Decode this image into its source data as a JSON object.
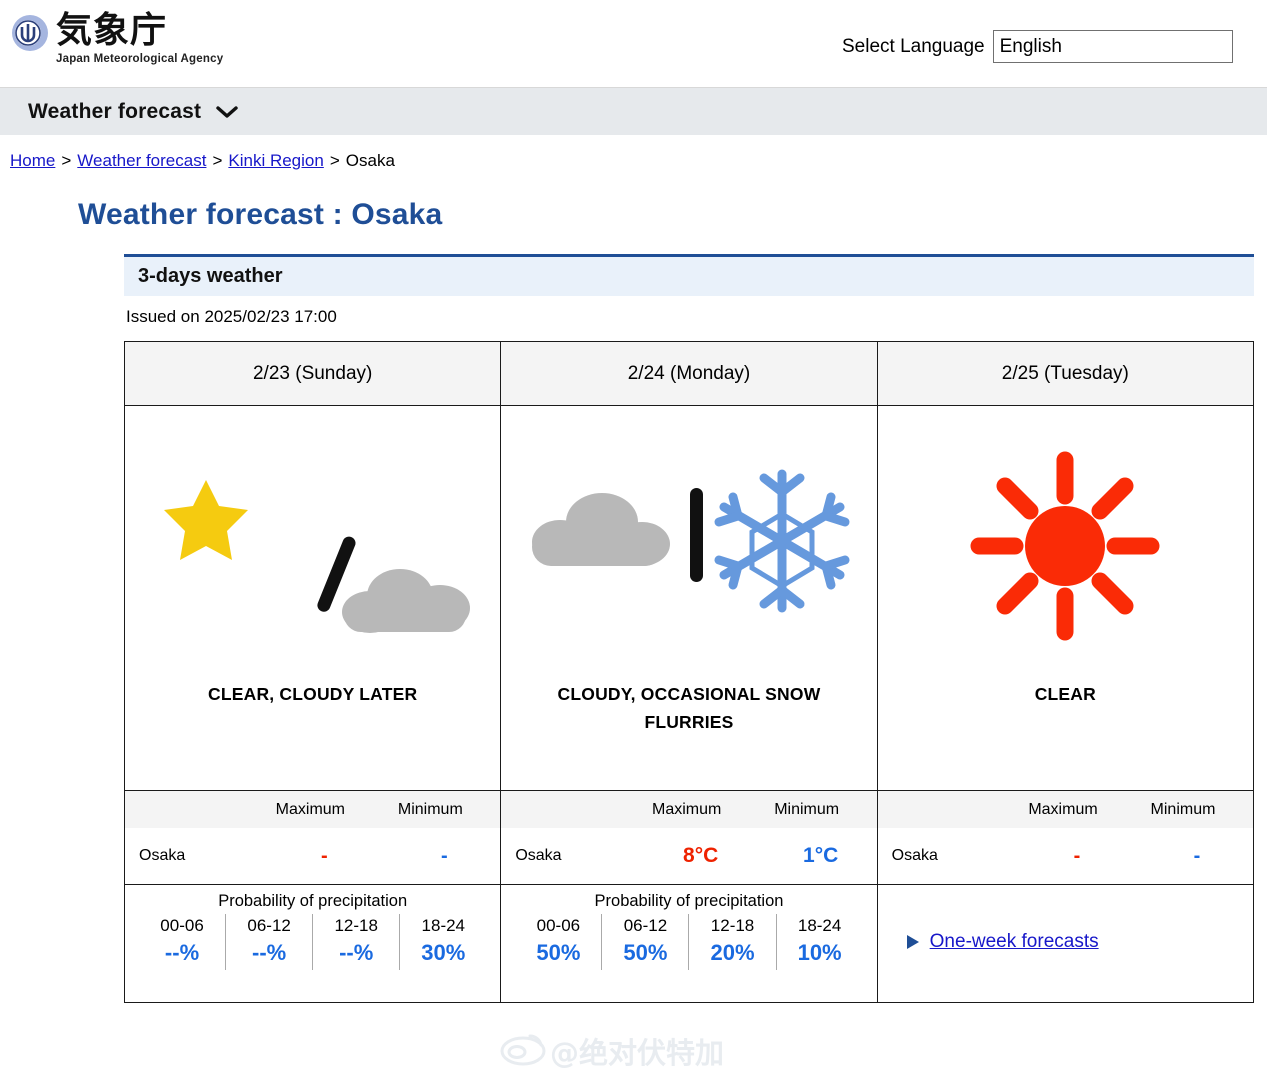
{
  "header": {
    "agency_jp": "気象庁",
    "agency_en": "Japan Meteorological Agency",
    "logo_icon": "jma-logo-icon",
    "language_label": "Select Language",
    "language_value": "English",
    "language_options": [
      "English"
    ]
  },
  "nav": {
    "title": "Weather forecast",
    "chevron_icon": "chevron-down-icon"
  },
  "breadcrumb": {
    "items": [
      {
        "label": "Home",
        "link": true
      },
      {
        "label": "Weather forecast",
        "link": true
      },
      {
        "label": "Kinki Region",
        "link": true
      },
      {
        "label": "Osaka",
        "link": false
      }
    ],
    "separator": ">"
  },
  "page": {
    "title": "Weather forecast : Osaka",
    "section_title": "3-days weather",
    "issued": "Issued on 2025/02/23 17:00",
    "accent_color": "#1f4e96"
  },
  "table": {
    "temp_headers": {
      "maximum": "Maximum",
      "minimum": "Minimum"
    },
    "pop_title": "Probability of precipitation",
    "pop_hours": [
      "00-06",
      "06-12",
      "12-18",
      "18-24"
    ],
    "city": "Osaka",
    "max_color": "#ee2200",
    "min_color": "#1a6ae0",
    "days": [
      {
        "date": "2/23 (Sunday)",
        "icon": "moon-star-to-cloud-icon",
        "weather": "CLEAR, CLOUDY LATER",
        "max": "-",
        "min": "-",
        "pop": [
          "--%",
          "--%",
          "--%",
          "30%"
        ]
      },
      {
        "date": "2/24 (Monday)",
        "icon": "cloud-snowflake-icon",
        "weather": "CLOUDY, OCCASIONAL SNOW FLURRIES",
        "max": "8°C",
        "min": "1°C",
        "pop": [
          "50%",
          "50%",
          "20%",
          "10%"
        ]
      },
      {
        "date": "2/25 (Tuesday)",
        "icon": "sun-icon",
        "weather": "CLEAR",
        "max": "-",
        "min": "-",
        "pop": []
      }
    ]
  },
  "oneweek": {
    "label": "One-week forecasts",
    "triangle_icon": "triangle-right-icon"
  },
  "watermark": {
    "icon": "weibo-logo-icon",
    "text": "@绝对伏特加"
  }
}
